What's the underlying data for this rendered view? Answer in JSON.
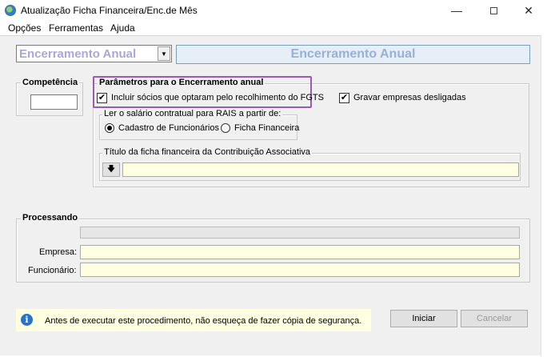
{
  "window": {
    "title": "Atualização Ficha Financeira/Enc.de Mês",
    "minimize_glyph": "—",
    "close_glyph": "✕"
  },
  "menu": {
    "items": [
      "Opções",
      "Ferramentas",
      "Ajuda"
    ]
  },
  "mode_selector": {
    "value": "Encerramento Anual",
    "arrow_glyph": "▼"
  },
  "banner": {
    "text": "Encerramento Anual"
  },
  "competencia": {
    "legend": "Competência",
    "value": ""
  },
  "parametros": {
    "legend": "Parâmetros para o Encerramento anual",
    "incluir_socios": {
      "label": "Incluir sócios que optaram pelo recolhimento do FGTS",
      "checked": true
    },
    "gravar_empresas": {
      "label": "Gravar empresas desligadas",
      "checked": true
    },
    "check_glyph": "✔",
    "salario_group": {
      "legend": "Ler o salário contratual para RAIS a partir de:",
      "options": [
        {
          "label": "Cadastro de Funcionários",
          "selected": true
        },
        {
          "label": "Ficha Financeira",
          "selected": false
        }
      ]
    },
    "titulo_group": {
      "legend": "Título da ficha financeira da Contribuição Associativa",
      "button_glyph": "🡇",
      "value": ""
    }
  },
  "processando": {
    "legend": "Processando",
    "progress": 0,
    "empresa_label": "Empresa:",
    "empresa_value": "",
    "funcionario_label": "Funcionário:",
    "funcionario_value": ""
  },
  "info": {
    "icon": "info-icon",
    "icon_glyph": "i",
    "text": "Antes de executar este procedimento, não esqueça de fazer cópia de segurança."
  },
  "buttons": {
    "iniciar": "Iniciar",
    "cancelar": "Cancelar"
  }
}
